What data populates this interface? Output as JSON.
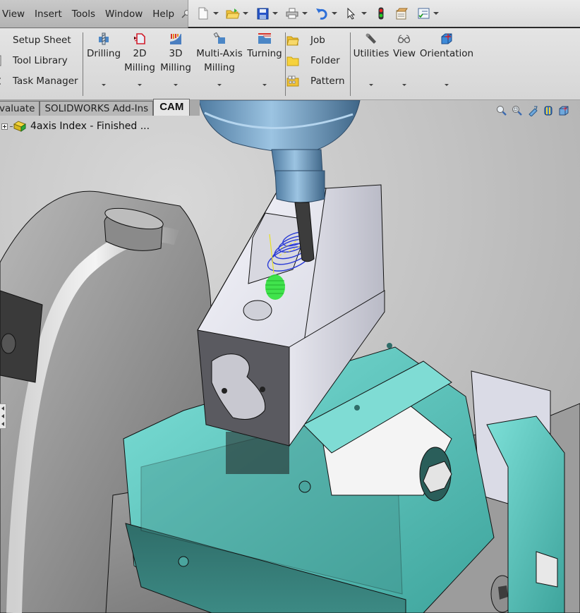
{
  "menubar": {
    "items": [
      "View",
      "Insert",
      "Tools",
      "Window",
      "Help"
    ],
    "pin_icon": "pushpin-icon"
  },
  "quick_toolbar": {
    "buttons": [
      {
        "icon": "new-document-icon",
        "has_dropdown": true
      },
      {
        "icon": "open-folder-icon",
        "has_dropdown": true
      },
      {
        "icon": "save-icon",
        "has_dropdown": true
      },
      {
        "icon": "print-icon",
        "has_dropdown": true
      },
      {
        "icon": "undo-icon",
        "has_dropdown": true
      },
      {
        "icon": "select-pointer-icon",
        "has_dropdown": true
      },
      {
        "icon": "rebuild-traffic-light-icon",
        "has_dropdown": false
      },
      {
        "icon": "file-properties-icon",
        "has_dropdown": false
      },
      {
        "icon": "options-checklist-icon",
        "has_dropdown": true
      }
    ]
  },
  "ribbon": {
    "left_items": [
      {
        "label": "Setup Sheet",
        "icon": "setup-sheet-icon"
      },
      {
        "label": "Tool Library",
        "icon": "tool-library-icon"
      },
      {
        "label": "Task Manager",
        "icon": "task-manager-icon"
      }
    ],
    "operation_buttons": [
      {
        "label_line1": "Drilling",
        "label_line2": "",
        "icon": "drilling-icon"
      },
      {
        "label_line1": "2D",
        "label_line2": "Milling",
        "icon": "2d-milling-icon"
      },
      {
        "label_line1": "3D",
        "label_line2": "Milling",
        "icon": "3d-milling-icon"
      },
      {
        "label_line1": "Multi-Axis",
        "label_line2": "Milling",
        "icon": "multi-axis-milling-icon"
      },
      {
        "label_line1": "Turning",
        "label_line2": "",
        "icon": "turning-icon"
      }
    ],
    "middle_items": [
      {
        "label": "Job",
        "icon": "job-folder-icon"
      },
      {
        "label": "Folder",
        "icon": "folder-icon"
      },
      {
        "label": "Pattern",
        "icon": "pattern-icon"
      }
    ],
    "right_buttons": [
      {
        "label": "Utilities",
        "icon": "wrench-icon"
      },
      {
        "label": "View",
        "icon": "glasses-icon"
      },
      {
        "label": "Orientation",
        "icon": "orientation-cube-icon"
      }
    ]
  },
  "tabs": [
    {
      "label": "valuate",
      "active": false
    },
    {
      "label": "SOLIDWORKS Add-Ins",
      "active": false
    },
    {
      "label": "CAM",
      "active": true
    }
  ],
  "feature_tree": {
    "root_label": "4axis Index - Finished ...",
    "root_icon": "part-icon"
  },
  "view_tools": [
    "zoom-to-fit-icon",
    "zoom-to-area-icon",
    "previous-view-icon",
    "section-view-icon",
    "view-orientation-icon"
  ],
  "colors": {
    "fixture_teal": "#5fc9c0",
    "spindle_blue": "#6e9cc0",
    "stock_white": "#e4e4ee",
    "toolpath_blue": "#2a3bd6",
    "toolpath_green": "#2ee23a",
    "toolpath_yellow": "#e8e020"
  }
}
